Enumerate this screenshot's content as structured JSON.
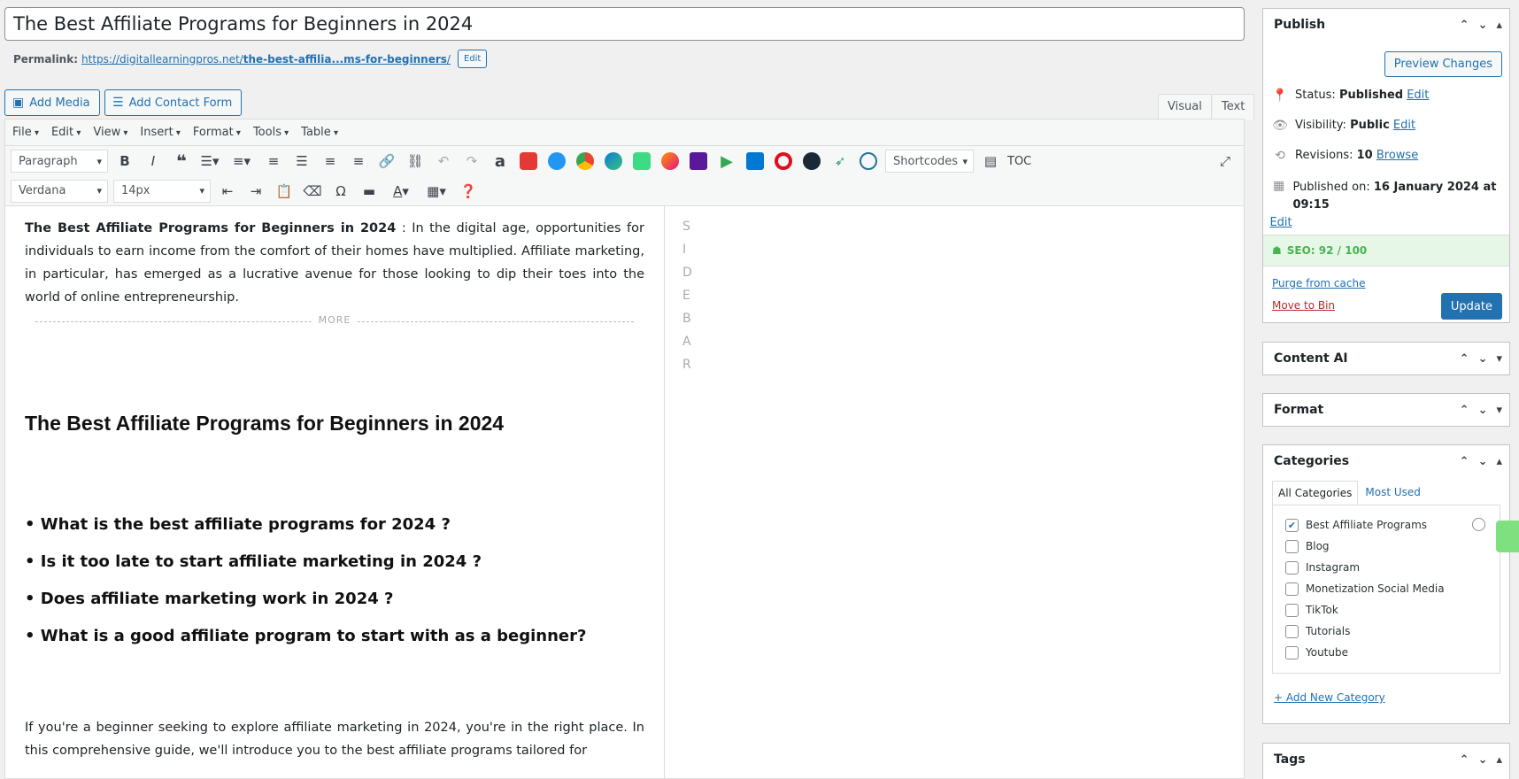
{
  "post": {
    "title": "The Best Affiliate Programs for Beginners in 2024",
    "permalink_label": "Permalink:",
    "permalink_base": "https://digitallearningpros.net/",
    "permalink_slug": "the-best-affilia...ms-for-beginners",
    "permalink_end": "/",
    "permalink_edit": "Edit"
  },
  "media": {
    "add_media": "Add Media",
    "add_contact_form": "Add Contact Form"
  },
  "editor_tabs": {
    "visual": "Visual",
    "text": "Text"
  },
  "menubar": [
    "File",
    "Edit",
    "View",
    "Insert",
    "Format",
    "Tools",
    "Table"
  ],
  "toolbar": {
    "paragraph": "Paragraph",
    "font": "Verdana",
    "size": "14px",
    "shortcodes": "Shortcodes",
    "toc": "TOC"
  },
  "content": {
    "intro_bold": "The Best Affiliate Programs for Beginners in 2024",
    "intro_rest": " : In the digital age, opportunities for individuals to earn income from the comfort of their homes have multiplied. Affiliate marketing, in particular, has emerged as a lucrative avenue for those looking to dip their toes into the world of online entrepreneurship.",
    "more": "MORE",
    "heading": "The Best Affiliate Programs for Beginners in 2024",
    "questions": [
      "What is the best affiliate programs for 2024 ?",
      "Is it too late to start affiliate marketing in 2024 ?",
      "Does affiliate marketing work in 2024 ?",
      "What is a good affiliate program to start with as a beginner?"
    ],
    "para2": "If you're a beginner seeking to explore affiliate marketing in 2024, you're in the right place. In this comprehensive guide, we'll introduce you to the best affiliate programs tailored for",
    "sidebar_letters": [
      "S",
      "I",
      "D",
      "E",
      "B",
      "A",
      "R"
    ]
  },
  "publish": {
    "title": "Publish",
    "preview": "Preview Changes",
    "status_label": "Status:",
    "status_value": "Published",
    "visibility_label": "Visibility:",
    "visibility_value": "Public",
    "revisions_label": "Revisions:",
    "revisions_value": "10",
    "browse": "Browse",
    "published_label": "Published on:",
    "published_value": "16 January 2024 at 09:15",
    "edit": "Edit",
    "seo": "SEO: 92 / 100",
    "purge": "Purge from cache",
    "move_to_bin": "Move to Bin",
    "update": "Update"
  },
  "boxes": {
    "content_ai": "Content AI",
    "format": "Format",
    "categories": "Categories",
    "tags": "Tags"
  },
  "categories": {
    "tab_all": "All Categories",
    "tab_most_used": "Most Used",
    "items": [
      {
        "label": "Best Affiliate Programs",
        "checked": true
      },
      {
        "label": "Blog",
        "checked": false
      },
      {
        "label": "Instagram",
        "checked": false
      },
      {
        "label": "Monetization Social Media",
        "checked": false
      },
      {
        "label": "TikTok",
        "checked": false
      },
      {
        "label": "Tutorials",
        "checked": false
      },
      {
        "label": "Youtube",
        "checked": false
      }
    ],
    "add_new": "+ Add New Category"
  },
  "colors": {
    "accent": "#2271b1",
    "seo_green": "#46b450",
    "update_button": "#2271b1"
  }
}
